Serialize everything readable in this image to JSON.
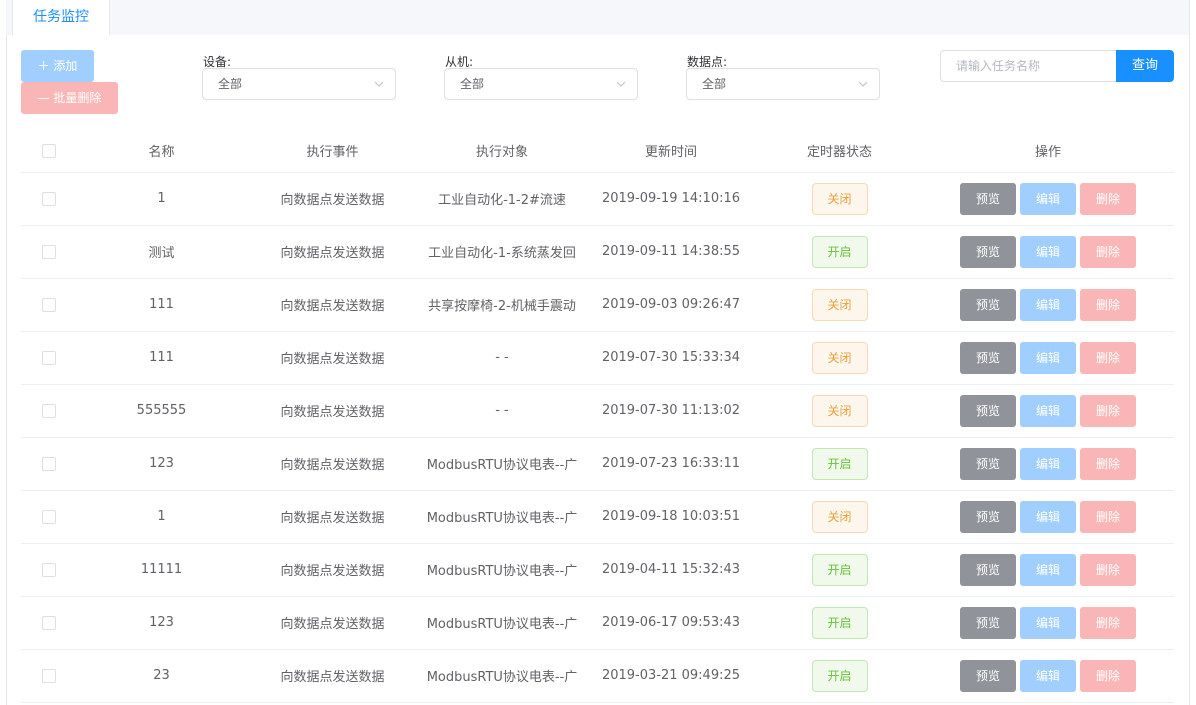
{
  "tabs": [
    {
      "label": "任务监控",
      "active": true
    }
  ],
  "toolbar": {
    "add_label": "添加",
    "batch_delete_label": "批量删除"
  },
  "filters": {
    "device": {
      "label": "设备:",
      "value": "全部"
    },
    "slave": {
      "label": "从机:",
      "value": "全部"
    },
    "datapoint": {
      "label": "数据点:",
      "value": "全部"
    }
  },
  "search": {
    "placeholder": "请输入任务名称",
    "value": "",
    "button_label": "查询"
  },
  "table": {
    "columns": [
      "名称",
      "执行事件",
      "执行对象",
      "更新时间",
      "定时器状态",
      "操作"
    ],
    "rows": [
      {
        "name": "1",
        "event": "向数据点发送数据",
        "target": "工业自动化-1-2#流速",
        "updated": "2019-09-19 14:10:16",
        "status": "关闭",
        "status_type": "off"
      },
      {
        "name": "测试",
        "event": "向数据点发送数据",
        "target": "工业自动化-1-系统蒸发回",
        "updated": "2019-09-11 14:38:55",
        "status": "开启",
        "status_type": "on"
      },
      {
        "name": "111",
        "event": "向数据点发送数据",
        "target": "共享按摩椅-2-机械手震动",
        "updated": "2019-09-03 09:26:47",
        "status": "关闭",
        "status_type": "off"
      },
      {
        "name": "111",
        "event": "向数据点发送数据",
        "target": "- -",
        "updated": "2019-07-30 15:33:34",
        "status": "关闭",
        "status_type": "off"
      },
      {
        "name": "555555",
        "event": "向数据点发送数据",
        "target": "- -",
        "updated": "2019-07-30 11:13:02",
        "status": "关闭",
        "status_type": "off"
      },
      {
        "name": "123",
        "event": "向数据点发送数据",
        "target": "ModbusRTU协议电表--广",
        "updated": "2019-07-23 16:33:11",
        "status": "开启",
        "status_type": "on"
      },
      {
        "name": "1",
        "event": "向数据点发送数据",
        "target": "ModbusRTU协议电表--广",
        "updated": "2019-09-18 10:03:51",
        "status": "关闭",
        "status_type": "off"
      },
      {
        "name": "11111",
        "event": "向数据点发送数据",
        "target": "ModbusRTU协议电表--广",
        "updated": "2019-04-11 15:32:43",
        "status": "开启",
        "status_type": "on"
      },
      {
        "name": "123",
        "event": "向数据点发送数据",
        "target": "ModbusRTU协议电表--广",
        "updated": "2019-06-17 09:53:43",
        "status": "开启",
        "status_type": "on"
      },
      {
        "name": "23",
        "event": "向数据点发送数据",
        "target": "ModbusRTU协议电表--广",
        "updated": "2019-03-21 09:49:25",
        "status": "开启",
        "status_type": "on"
      }
    ],
    "actions": {
      "preview": "预览",
      "edit": "编辑",
      "delete": "删除"
    }
  },
  "colors": {
    "primary": "#1890ff",
    "warning": "#e6a23c",
    "success": "#67c23a",
    "info": "#909399"
  }
}
